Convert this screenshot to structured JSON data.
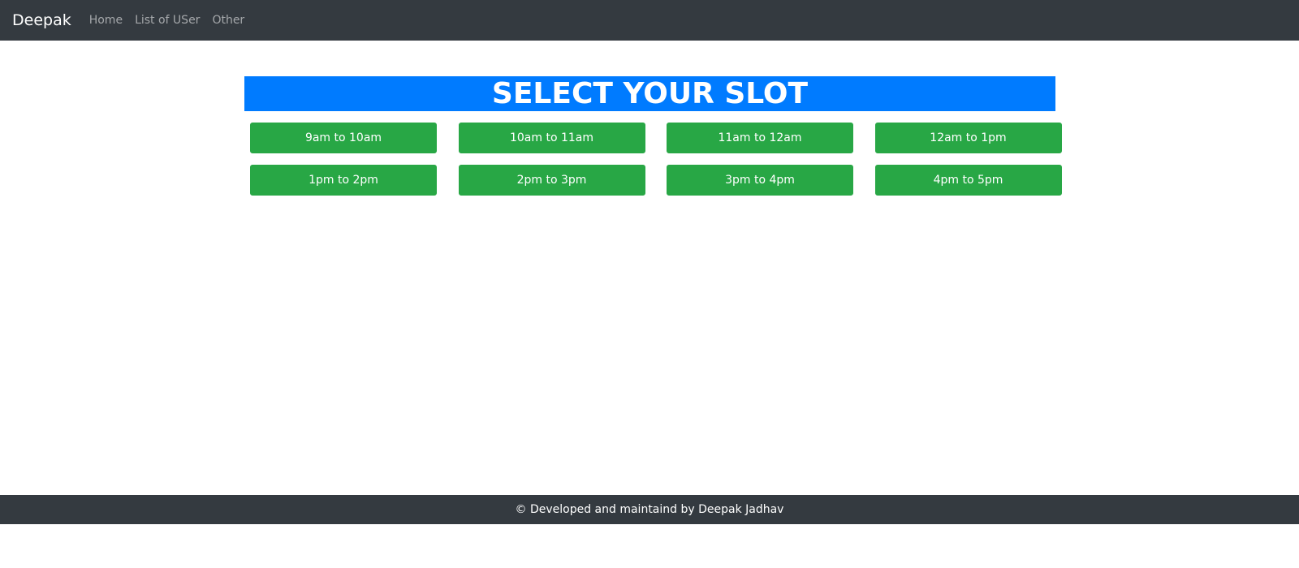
{
  "navbar": {
    "brand": "Deepak",
    "links": [
      {
        "label": "Home"
      },
      {
        "label": "List of USer"
      },
      {
        "label": "Other"
      }
    ]
  },
  "main": {
    "heading": "SELECT YOUR SLOT",
    "slots": [
      "9am to 10am",
      "10am to 11am",
      "11am to 12am",
      "12am to 1pm",
      "1pm to 2pm",
      "2pm to 3pm",
      "3pm to 4pm",
      "4pm to 5pm"
    ]
  },
  "footer": {
    "text": "© Developed and maintaind by Deepak Jadhav"
  },
  "colors": {
    "navbar_bg": "#343a40",
    "heading_bg": "#007bff",
    "slot_button_bg": "#28a745",
    "footer_bg": "#343a40"
  }
}
